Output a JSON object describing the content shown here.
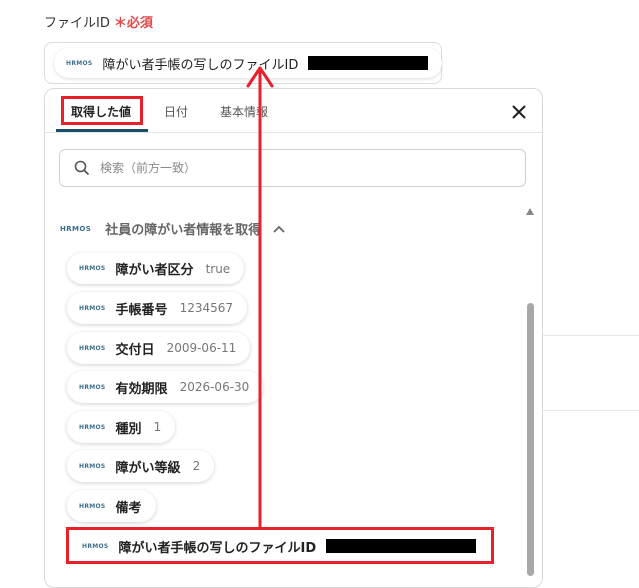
{
  "field": {
    "label": "ファイルID",
    "required_mark": "＊",
    "required_text": "必須",
    "value_icon": "HRMOS",
    "value_text": "障がい者手帳の写しのファイルID"
  },
  "tabs": [
    {
      "label": "取得した値"
    },
    {
      "label": "日付"
    },
    {
      "label": "基本情報"
    }
  ],
  "search": {
    "placeholder": "検索（前方一致）"
  },
  "group": {
    "logo": "HRMOS",
    "title": "社員の障がい者情報を取得"
  },
  "items": [
    {
      "icon": "HRMOS",
      "label": "障がい者区分",
      "value": "true"
    },
    {
      "icon": "HRMOS",
      "label": "手帳番号",
      "value": "1234567"
    },
    {
      "icon": "HRMOS",
      "label": "交付日",
      "value": "2009-06-11"
    },
    {
      "icon": "HRMOS",
      "label": "有効期限",
      "value": "2026-06-30"
    },
    {
      "icon": "HRMOS",
      "label": "種別",
      "value": "1"
    },
    {
      "icon": "HRMOS",
      "label": "障がい等級",
      "value": "2"
    },
    {
      "icon": "HRMOS",
      "label": "備考",
      "value": ""
    },
    {
      "icon": "HRMOS",
      "label": "障がい者手帳の写しのファイルID",
      "value": ""
    }
  ],
  "colors": {
    "highlight": "#e8202a",
    "tab_underline": "#1a4f6b",
    "required": "#e04a4a"
  }
}
